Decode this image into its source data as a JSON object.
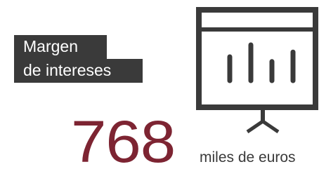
{
  "label": {
    "line1": "Margen",
    "line2": "de intereses"
  },
  "value": "768",
  "unit": "miles de euros",
  "colors": {
    "label_bg": "#3a3a3a",
    "label_text": "#ffffff",
    "value_text": "#7d2432",
    "icon_stroke": "#3a3a3a"
  },
  "icon": "presentation-board-bar-chart-icon",
  "chart_bars_in_icon": [
    2,
    3,
    1.6,
    2.4
  ]
}
